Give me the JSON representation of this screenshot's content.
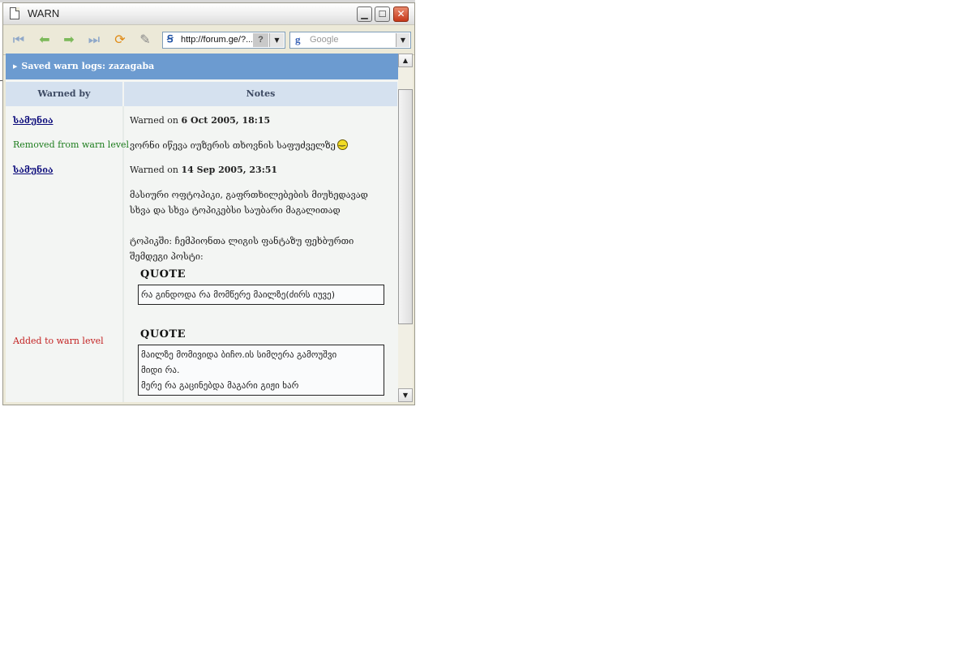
{
  "window": {
    "title": "WARN"
  },
  "toolbar": {
    "url": "http://forum.ge/?...",
    "help": "?",
    "search_placeholder": "Google"
  },
  "page": {
    "header": "Saved warn logs: zazagaba",
    "columns": [
      "Warned by",
      "Notes"
    ],
    "entries": [
      {
        "user": "სამუნია",
        "status": "Removed from warn level",
        "date_prefix": "Warned on",
        "date": "6 Oct 2005, 18:15",
        "note": "ვორნი იწევა იუზერის თხოვნის საფუძველზე"
      },
      {
        "user": "სამუნია",
        "status": "Added to warn level",
        "date_prefix": "Warned on",
        "date": "14 Sep 2005, 23:51",
        "note_lines": [
          "მასიური ოფტოპიკი, გაფრთხილებების მიუხედავად",
          "სხვა და სხვა ტოპიკებსი საუბარი მაგალითად",
          "ტოპიკში: ჩემპიონთა ლიგის ფანტაზუ ფეხბურთი",
          "შემდეგი პოსტი:"
        ],
        "quotes": [
          {
            "label": "QUOTE",
            "lines": [
              "რა გინდოდა რა მომწერე მაილზე(ძირს იუვე)"
            ]
          },
          {
            "label": "QUOTE",
            "lines": [
              "მაილზე მომივიდა ბიჩო.ის სიმღერა გამოუშვი",
              "მიდი რა.",
              "მერე რა გაცინებდა    მაგარი გიჟი ხარ"
            ]
          }
        ]
      }
    ]
  },
  "icons": {
    "first": "first-page-icon",
    "back": "back-arrow-icon",
    "forward": "forward-arrow-icon",
    "last": "last-page-icon",
    "refresh": "refresh-icon",
    "edit": "pencil-icon"
  },
  "colors": {
    "header_bar": "#6c9bd0",
    "column_header": "#d5e1ef",
    "removed_status": "#1d7d1d",
    "added_status": "#c32121"
  }
}
